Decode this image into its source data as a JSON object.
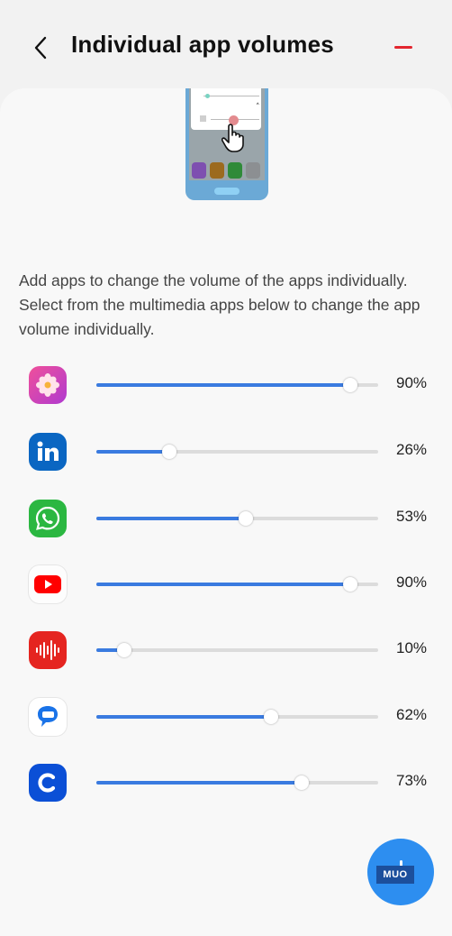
{
  "header": {
    "title": "Individual app volumes",
    "back_icon": "chevron-left-icon",
    "remove_icon": "minus-icon",
    "accent_color": "#e3262f"
  },
  "description": "Add apps to change the volume of the apps individually. Select from the multimedia apps below to change the app volume individually.",
  "slider_color": "#3a7be0",
  "apps": [
    {
      "icon": "gallery-flower-icon",
      "volume": 90,
      "label": "90%"
    },
    {
      "icon": "linkedin-icon",
      "volume": 26,
      "label": "26%"
    },
    {
      "icon": "whatsapp-icon",
      "volume": 53,
      "label": "53%"
    },
    {
      "icon": "youtube-icon",
      "volume": 90,
      "label": "90%"
    },
    {
      "icon": "voice-recorder-icon",
      "volume": 10,
      "label": "10%"
    },
    {
      "icon": "messages-icon",
      "volume": 62,
      "label": "62%"
    },
    {
      "icon": "c-app-icon",
      "volume": 73,
      "label": "73%"
    }
  ],
  "fab": {
    "icon": "plus-icon",
    "watermark": "MUO"
  }
}
